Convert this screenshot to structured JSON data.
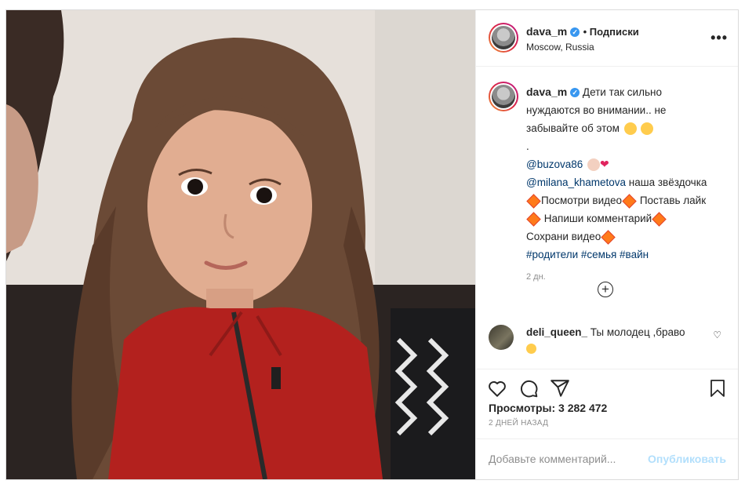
{
  "header": {
    "username": "dava_m",
    "follow_label": "• Подписки",
    "location": "Moscow, Russia",
    "more_label": "•••"
  },
  "caption": {
    "username": "dava_m",
    "lines": [
      "Дети так сильно",
      "нуждаются во внимании.. не",
      "забывайте об этом",
      "."
    ],
    "mention1": "@buzova86",
    "mention2": "@milana_khametova",
    "mention2_text": " наша звёздочка",
    "cta1": "Посмотри видео",
    "cta2": "Поставь лайк",
    "cta3": "Напиши комментарий",
    "cta4": "Сохрани видео",
    "hashtags": "#родители #семья #вайн",
    "time": "2 дн."
  },
  "comment": {
    "username": "deli_queen_",
    "text": " Ты молодец ,браво"
  },
  "stats": {
    "views": "Просмотры: 3 282 472",
    "date": "2 ДНЕЙ НАЗАД"
  },
  "add_comment": {
    "placeholder": "Добавьте комментарий...",
    "publish": "Опубликовать"
  },
  "colors": {
    "accent": "#3897f0",
    "link": "#00376b",
    "publish_disabled": "#b2dffc",
    "jacket": "#b3211e"
  },
  "icons": [
    "verified-icon",
    "more-icon",
    "load-more-plus-icon",
    "heart-icon",
    "comment-icon",
    "share-icon",
    "bookmark-icon"
  ]
}
